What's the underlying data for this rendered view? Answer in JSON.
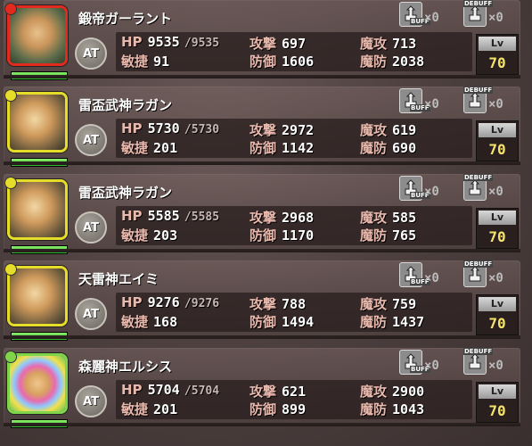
{
  "labels": {
    "hp": "HP",
    "speed": "敏捷",
    "attack": "攻撃",
    "defense": "防御",
    "magic_attack": "魔攻",
    "magic_defense": "魔防",
    "lv": "Lv",
    "at": "AT",
    "buff": "BUFF",
    "debuff": "DEBUFF"
  },
  "units": [
    {
      "name": "鍛帝ガーラント",
      "element": "fire",
      "element_color": "#e22a1e",
      "hp": "9535",
      "hp_max": "/9535",
      "speed": "91",
      "attack": "697",
      "defense": "1606",
      "magic_attack": "713",
      "magic_defense": "2038",
      "level": "70",
      "buff_count": "×0",
      "debuff_count": "×0",
      "hp_ratio": 1.0
    },
    {
      "name": "雷盃武神ラガン",
      "element": "thunder",
      "element_color": "#e6dc2a",
      "hp": "5730",
      "hp_max": "/5730",
      "speed": "201",
      "attack": "2972",
      "defense": "1142",
      "magic_attack": "619",
      "magic_defense": "690",
      "level": "70",
      "buff_count": "×0",
      "debuff_count": "×0",
      "hp_ratio": 1.0
    },
    {
      "name": "雷盃武神ラガン",
      "element": "thunder",
      "element_color": "#e6dc2a",
      "hp": "5585",
      "hp_max": "/5585",
      "speed": "203",
      "attack": "2968",
      "defense": "1170",
      "magic_attack": "585",
      "magic_defense": "765",
      "level": "70",
      "buff_count": "×0",
      "debuff_count": "×0",
      "hp_ratio": 1.0
    },
    {
      "name": "天雷神エイミ",
      "element": "thunder",
      "element_color": "#e6dc2a",
      "hp": "9276",
      "hp_max": "/9276",
      "speed": "168",
      "attack": "788",
      "defense": "1494",
      "magic_attack": "759",
      "magic_defense": "1437",
      "level": "70",
      "buff_count": "×0",
      "debuff_count": "×0",
      "hp_ratio": 1.0
    },
    {
      "name": "森麗神エルシス",
      "element": "wood",
      "element_color": "#7fd44a",
      "hp": "5704",
      "hp_max": "/5704",
      "speed": "201",
      "attack": "621",
      "defense": "899",
      "magic_attack": "2900",
      "magic_defense": "1043",
      "level": "70",
      "buff_count": "×0",
      "debuff_count": "×0",
      "hp_ratio": 1.0
    }
  ]
}
